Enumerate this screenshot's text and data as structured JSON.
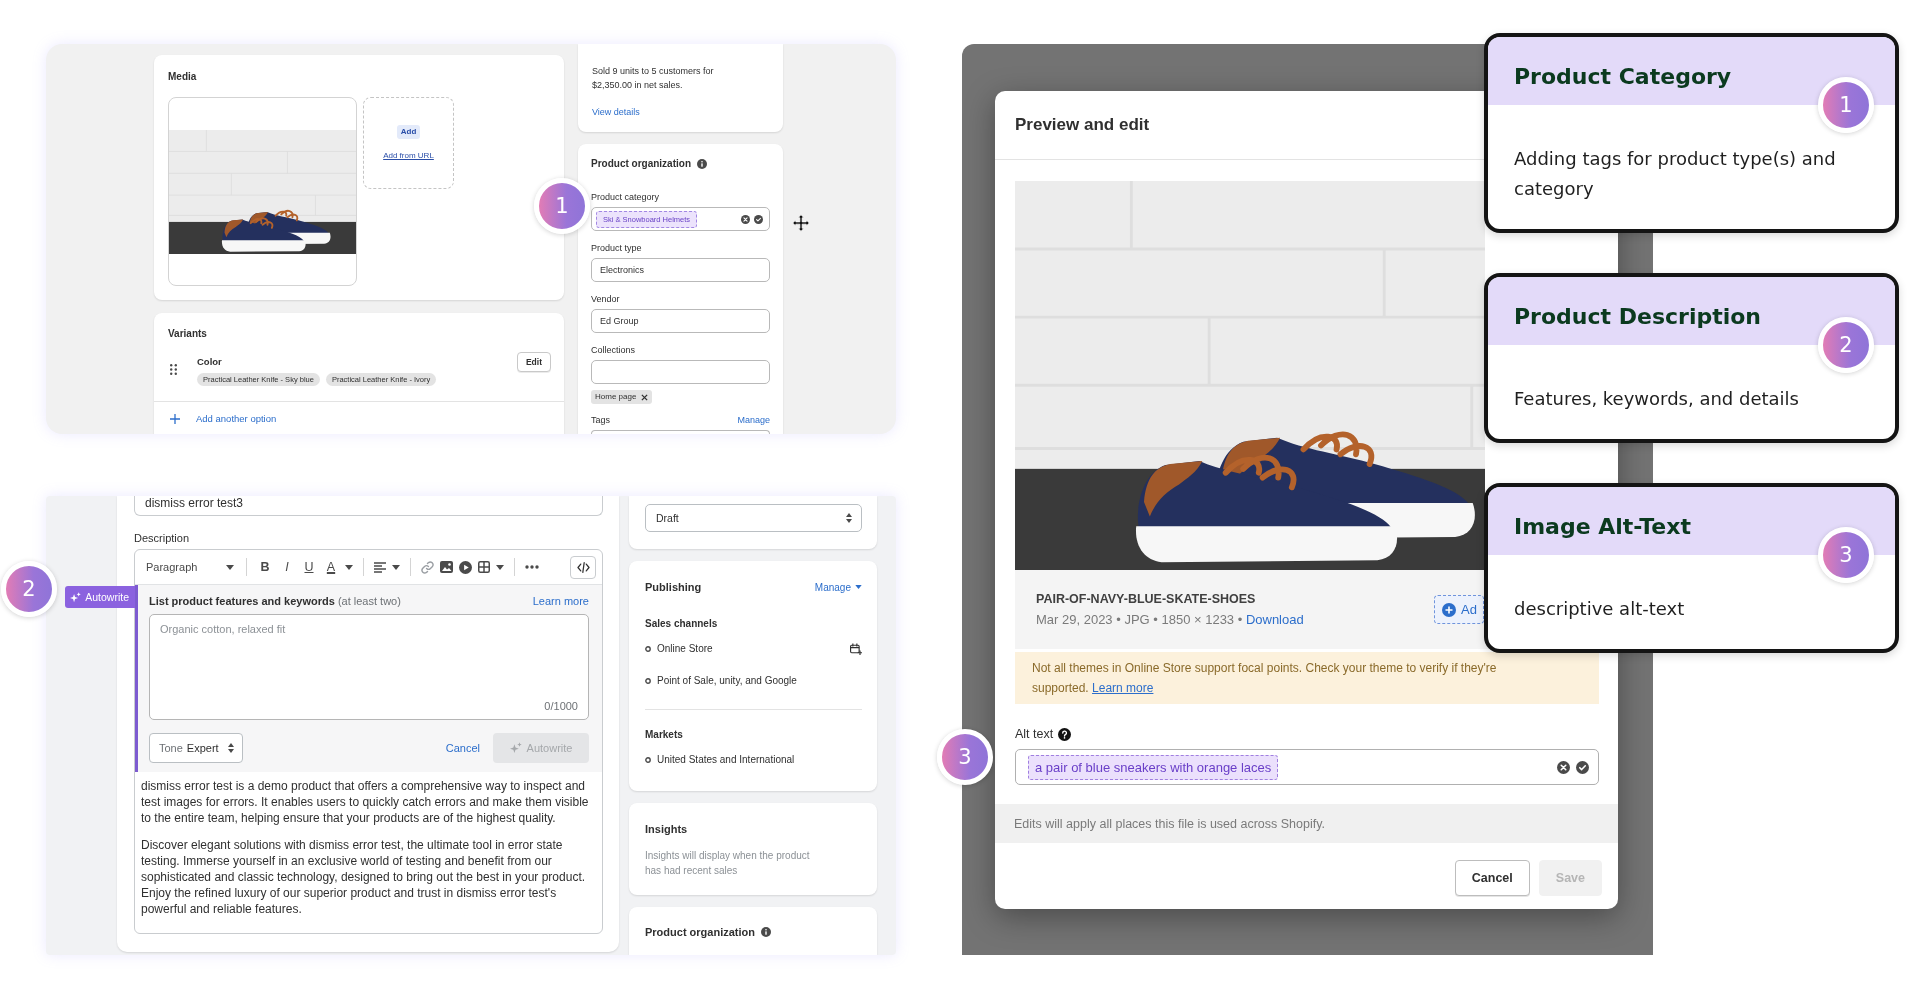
{
  "product_page": {
    "media": {
      "title": "Media",
      "add_button": "Add",
      "add_link": "Add from URL"
    },
    "variants": {
      "title": "Variants",
      "option": "Color",
      "values": [
        "Practical Leather Knife - Sky blue",
        "Practical Leather Knife - Ivory"
      ],
      "edit": "Edit",
      "add_option": "Add another option"
    },
    "insights": {
      "summary": "Sold 9 units to 5 customers for $2,350.00 in net sales.",
      "link": "View details"
    },
    "organization": {
      "title": "Product organization",
      "fields": [
        {
          "kind": "tag",
          "label": "Product category",
          "value": "Ski & Snowboard Helmets"
        },
        {
          "kind": "text",
          "label": "Product type",
          "value": "Electronics"
        },
        {
          "kind": "text",
          "label": "Vendor",
          "value": "Ed Group"
        },
        {
          "kind": "chips",
          "label": "Collections",
          "chips": [
            "Home page"
          ]
        }
      ],
      "tags_label": "Tags",
      "tags_action": "Manage"
    },
    "marker": "1"
  },
  "description_page": {
    "editor": {
      "title_value": "dismiss error test3",
      "label": "Description",
      "toolbar": [
        {
          "kind": "dropdown",
          "label": "Paragraph"
        },
        {
          "kind": "bold",
          "label": "B"
        },
        {
          "kind": "italic",
          "label": "I"
        },
        {
          "kind": "underline",
          "label": "U"
        },
        {
          "kind": "color",
          "label": "A"
        }
      ],
      "autowrite_tag": "Autowrite",
      "prompt": "**List product features and keywords** (at least two)",
      "learn_more": "Learn more",
      "placeholder": "Organic cotton, relaxed fit",
      "counter": "0/1000",
      "tone": {
        "label": "Tone",
        "value": "Expert"
      },
      "cancel": "Cancel",
      "autowrite_button": {
        "label": "Autowrite",
        "disabled": true
      },
      "paragraphs": [
        "dismiss error test is a demo product that offers a comprehensive way to inspect and test images for errors. It enables users to quickly catch errors and make them visible to the entire team, helping ensure that your products are of the highest quality.",
        "Discover elegant solutions with dismiss error test, the ultimate tool in error state testing. Immerse yourself in an exclusive world of testing and benefit from our sophisticated and classic technology, designed to bring out the best in your product. Enjoy the refined luxury of our superior product and trust in dismiss error test's powerful and reliable features."
      ]
    },
    "sidebar": {
      "status": "Draft",
      "publishing": {
        "title": "Publishing",
        "action": "Manage",
        "channels_label": "Sales channels",
        "channels": [
          "Online Store",
          "Point of Sale, unity, and Google"
        ],
        "markets_label": "Markets",
        "markets": [
          "United States and International"
        ]
      },
      "insights": {
        "title": "Insights",
        "text": "Insights will display when the product has had recent sales"
      },
      "organization_title": "Product organization"
    },
    "marker": "2"
  },
  "preview_modal": {
    "title": "Preview and edit",
    "file_name": "PAIR-OF-NAVY-BLUE-SKATE-SHOES",
    "file_meta": "Mar 29, 2023 • JPG • 1850 × 1233 •",
    "download": "Download",
    "add_button": "Ad",
    "notice": "Not all themes in Online Store support focal points. Check your theme to verify if they're supported.",
    "notice_link": "Learn more",
    "alt_label": "Alt text",
    "alt_value": "a pair of blue sneakers with orange laces",
    "footer_note": "Edits will apply all places this file is used across Shopify.",
    "buttons": [
      {
        "label": "Cancel",
        "disabled": false
      },
      {
        "label": "Save",
        "disabled": true
      }
    ],
    "marker": "3"
  },
  "callouts": [
    {
      "number": "1",
      "title": "Product Category",
      "text": "Adding tags for product type(s) and category"
    },
    {
      "number": "2",
      "title": "Product Description",
      "text": "Features, keywords, and details"
    },
    {
      "number": "3",
      "title": "Image Alt-Text",
      "text": "descriptive alt-text"
    }
  ]
}
